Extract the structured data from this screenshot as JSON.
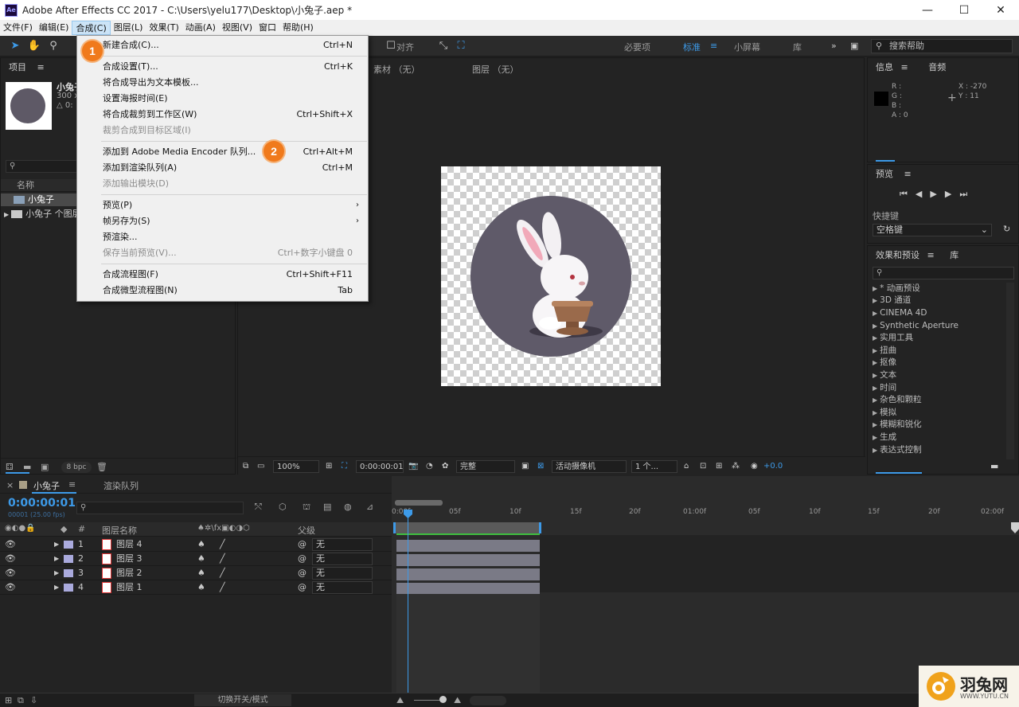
{
  "window": {
    "title": "Adobe After Effects CC 2017 - C:\\Users\\yelu177\\Desktop\\小兔子.aep *",
    "app_icon": "Ae",
    "minimize": "—",
    "maximize": "☐",
    "close": "✕"
  },
  "menubar": {
    "items": [
      "文件(F)",
      "编辑(E)",
      "合成(C)",
      "图层(L)",
      "效果(T)",
      "动画(A)",
      "视图(V)",
      "窗口",
      "帮助(H)"
    ]
  },
  "toolbar": {
    "align_label": "对齐",
    "workspaces": [
      "必要项",
      "标准",
      "小屏幕",
      "库"
    ],
    "active_workspace": "标准",
    "search_help": "搜索帮助"
  },
  "composition_menu": {
    "items": [
      {
        "label": "新建合成(C)...",
        "shortcut": "Ctrl+N"
      },
      {
        "label": "合成设置(T)...",
        "shortcut": "Ctrl+K"
      },
      {
        "label": "将合成导出为文本模板...",
        "shortcut": ""
      },
      {
        "label": "设置海报时间(E)",
        "shortcut": ""
      },
      {
        "label": "将合成裁剪到工作区(W)",
        "shortcut": "Ctrl+Shift+X"
      },
      {
        "label": "裁剪合成到目标区域(I)",
        "shortcut": ""
      },
      {
        "label": "添加到 Adobe Media Encoder 队列...",
        "shortcut": "Ctrl+Alt+M"
      },
      {
        "label": "添加到渲染队列(A)",
        "shortcut": "Ctrl+M"
      },
      {
        "label": "添加输出模块(D)",
        "shortcut": ""
      },
      {
        "label": "预览(P)",
        "shortcut": ""
      },
      {
        "label": "帧另存为(S)",
        "shortcut": ""
      },
      {
        "label": "预渲染...",
        "shortcut": ""
      },
      {
        "label": "保存当前预览(V)...",
        "shortcut": "Ctrl+数字小键盘 0"
      },
      {
        "label": "合成流程图(F)",
        "shortcut": "Ctrl+Shift+F11"
      },
      {
        "label": "合成微型流程图(N)",
        "shortcut": "Tab"
      }
    ],
    "step1": "1",
    "step2": "2"
  },
  "project": {
    "tab": "项目",
    "comp_name": "小兔子",
    "comp_size": "300 x",
    "comp_delta": "△ 0:",
    "search_icon": "⚲",
    "name_header": "名称",
    "rows": [
      "小兔子",
      "小兔子 个图层"
    ],
    "bpc": "8 bpc"
  },
  "viewer": {
    "footage_label": "素材 （无）",
    "layer_label": "图层 （无）",
    "zoom": "100%",
    "timecode": "0:00:00:01",
    "resolution": "完整",
    "camera": "活动摄像机",
    "views": "1 个...",
    "exposure": "+0.0"
  },
  "info": {
    "tab": "信息",
    "tab2": "音频",
    "r": "R :",
    "g": "G :",
    "b": "B :",
    "a": "A : 0",
    "x": "X : -270",
    "y": "Y : 11"
  },
  "preview": {
    "tab": "预览",
    "shortcut_label": "快捷键",
    "shortcut_value": "空格键"
  },
  "effects": {
    "tab": "效果和预设",
    "tab2": "库",
    "items": [
      "* 动画预设",
      "3D 通道",
      "CINEMA 4D",
      "Synthetic Aperture",
      "实用工具",
      "扭曲",
      "抠像",
      "文本",
      "时间",
      "杂色和颗粒",
      "模拟",
      "模糊和锐化",
      "生成",
      "表达式控制"
    ]
  },
  "timeline": {
    "comp_tab": "小兔子",
    "render_tab": "渲染队列",
    "timecode": "0:00:00:01",
    "fps": "00001 (25.00 fps)",
    "col_hash": "#",
    "col_name": "图层名称",
    "col_parent": "父级",
    "layers": [
      {
        "num": "1",
        "name": "图层 4",
        "parent": "无"
      },
      {
        "num": "2",
        "name": "图层 3",
        "parent": "无"
      },
      {
        "num": "3",
        "name": "图层 2",
        "parent": "无"
      },
      {
        "num": "4",
        "name": "图层 1",
        "parent": "无"
      }
    ],
    "ruler": [
      "0:00f",
      "05f",
      "10f",
      "15f",
      "20f",
      "01:00f",
      "05f",
      "10f",
      "15f",
      "20f",
      "02:00f"
    ],
    "toggle_label": "切换开关/模式"
  },
  "watermark": {
    "brand": "羽兔网",
    "url": "WWW.YUTU.CN"
  },
  "colors": {
    "accent": "#3d9ae8",
    "step_badge": "#f07a1c",
    "bunny_disc": "#5f5a69"
  }
}
